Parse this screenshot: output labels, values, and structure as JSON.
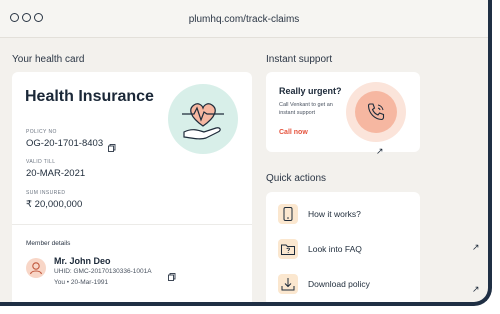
{
  "browser": {
    "url": "plumhq.com/track-claims"
  },
  "health_card": {
    "section_title": "Your health card",
    "title": "Health Insurance",
    "policy_no_label": "POLICY NO",
    "policy_no": "OG-20-1701-8403",
    "valid_till_label": "VALID TILL",
    "valid_till": "20-MAR-2021",
    "sum_insured_label": "SUM INSURED",
    "sum_insured": "₹ 20,000,000",
    "member_details_label": "Member details",
    "member": {
      "name": "Mr. John Deo",
      "uhid": "UHID: GMC-20170130336-1001A",
      "meta": "You • 20-Mar-1991"
    }
  },
  "instant_support": {
    "section_title": "Instant support",
    "title": "Really urgent?",
    "subtitle": "Call Venkant to get an instant support",
    "link": "Call now"
  },
  "quick_actions": {
    "section_title": "Quick actions",
    "items": [
      {
        "label": "How it works?",
        "icon": "phone-help-icon"
      },
      {
        "label": "Look into FAQ",
        "icon": "faq-folder-icon"
      },
      {
        "label": "Download policy",
        "icon": "download-icon"
      }
    ]
  },
  "colors": {
    "background": "#f3f1ed",
    "accent_red": "#e5533d",
    "frame": "#1f2f44"
  }
}
